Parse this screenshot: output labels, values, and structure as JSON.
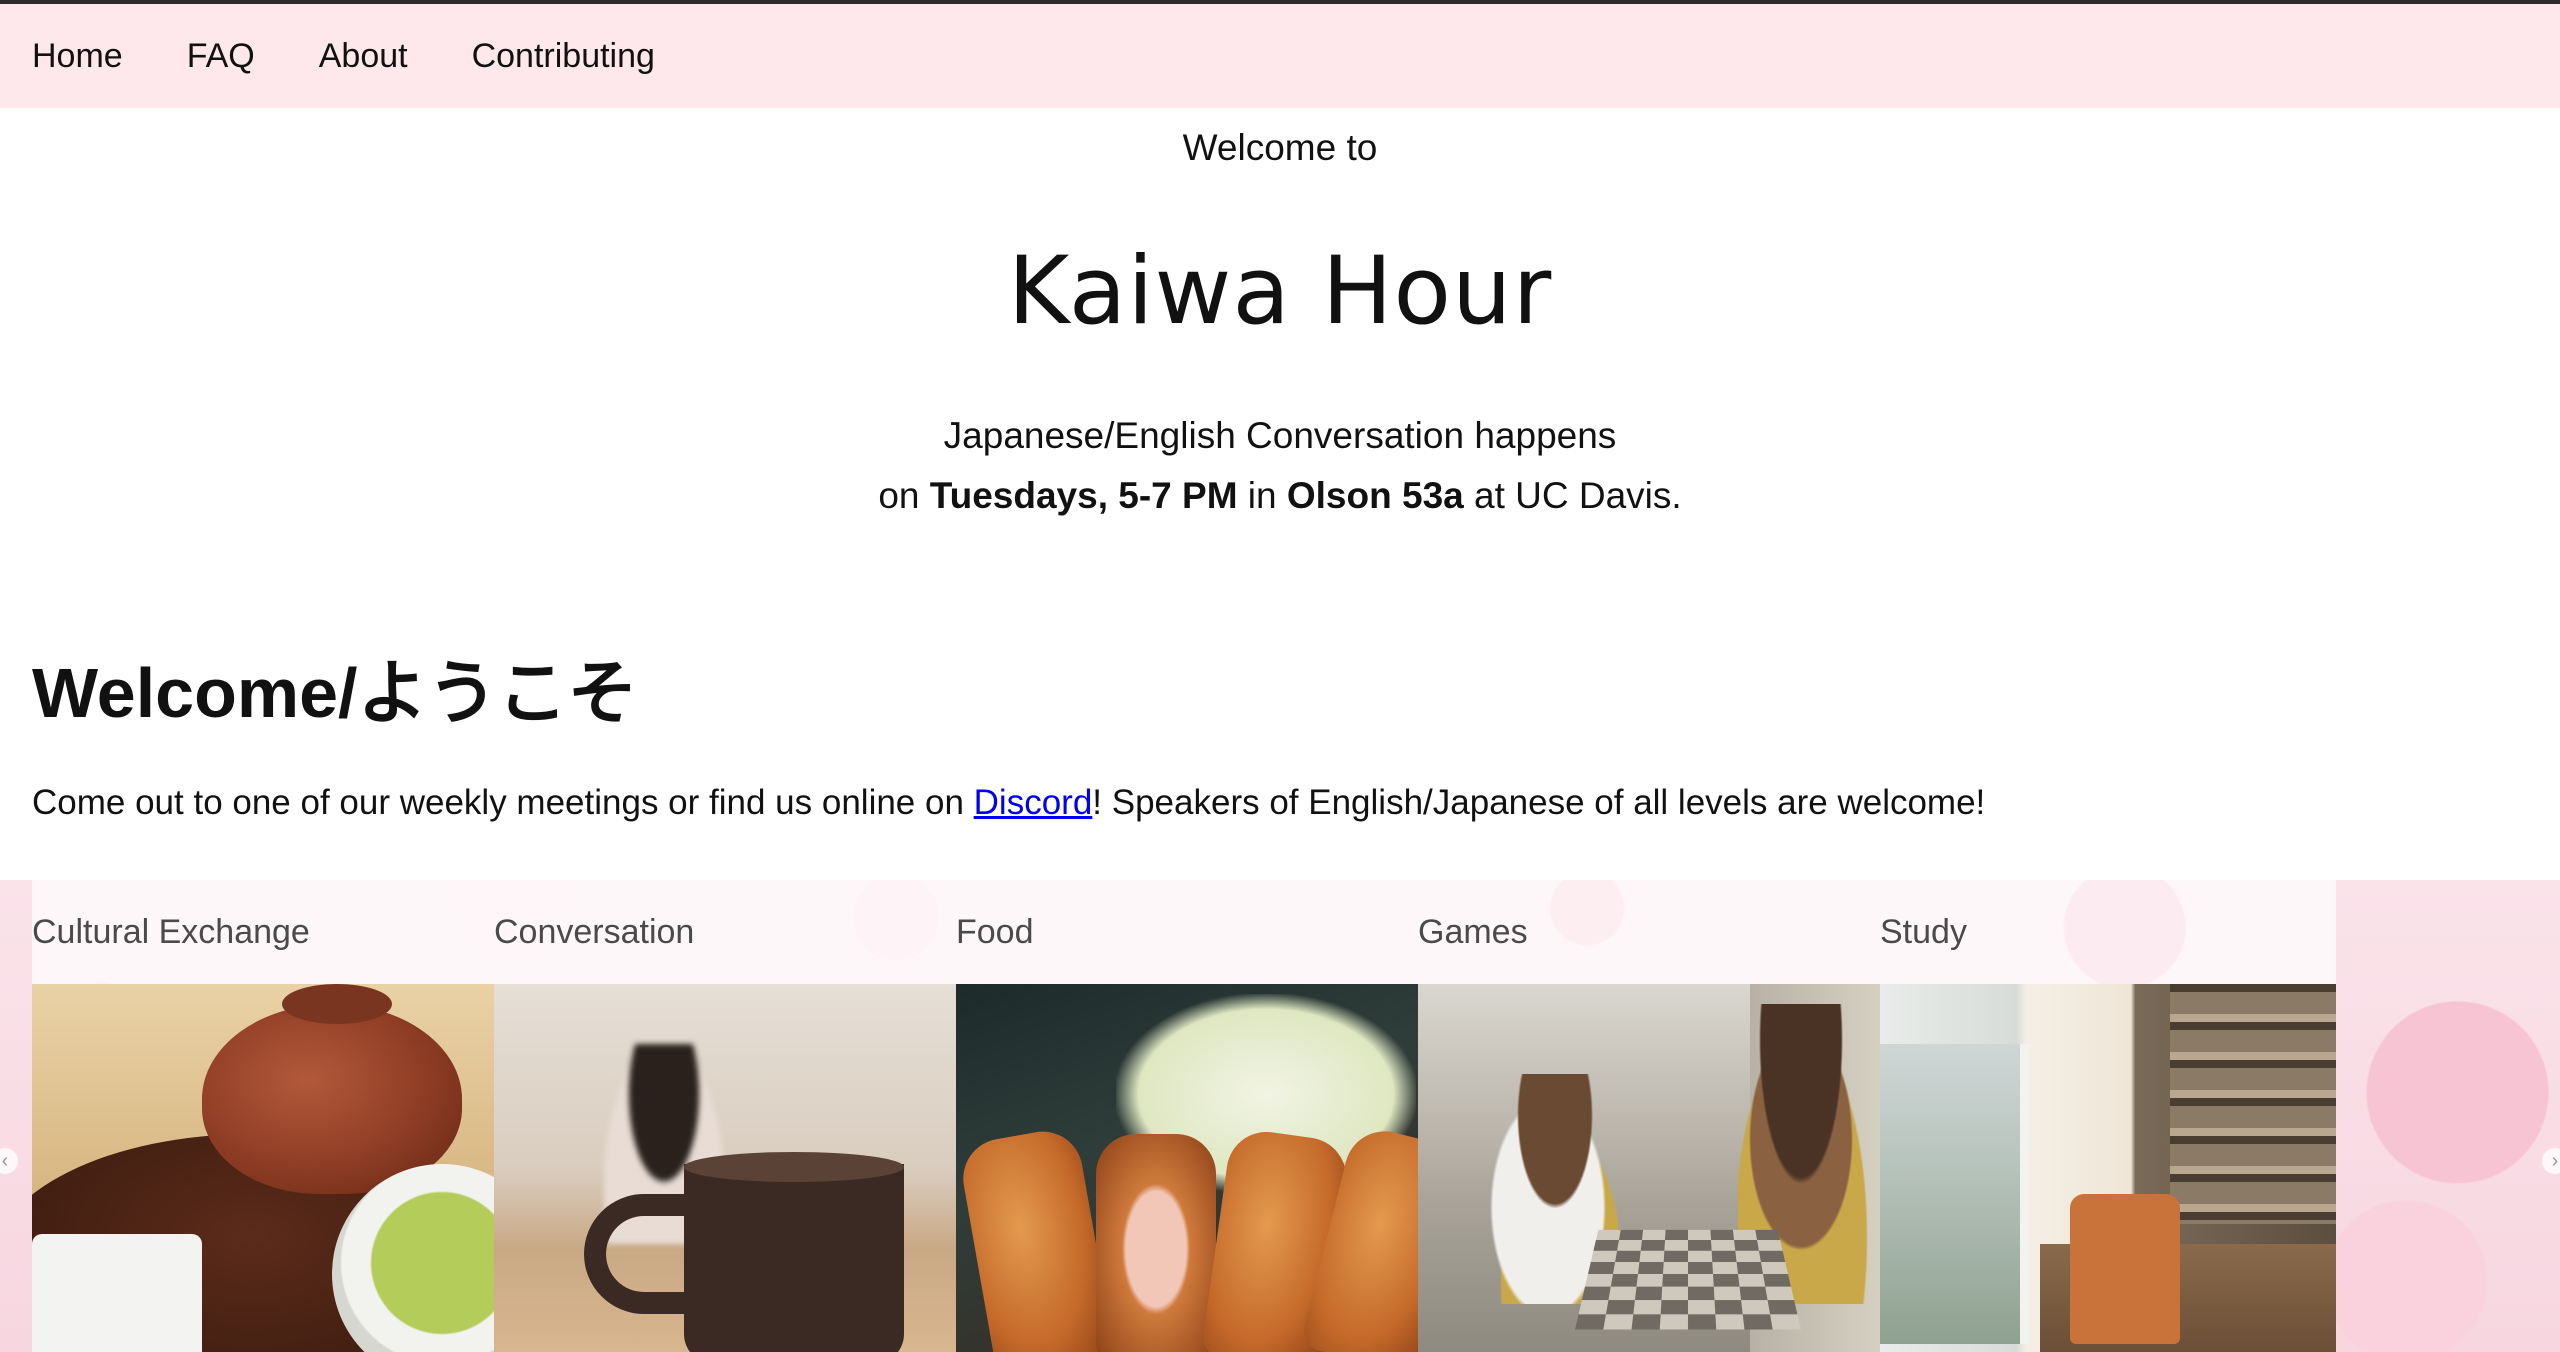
{
  "nav": {
    "items": [
      {
        "label": "Home"
      },
      {
        "label": "FAQ"
      },
      {
        "label": "About"
      },
      {
        "label": "Contributing"
      }
    ]
  },
  "hero": {
    "welcome_to": "Welcome to",
    "title": "Kaiwa Hour",
    "tagline_line1": "Japanese/English Conversation happens",
    "tagline_on": "on ",
    "tagline_when": "Tuesdays, 5-7 PM",
    "tagline_in": " in ",
    "tagline_where": "Olson 53a",
    "tagline_end": " at UC Davis."
  },
  "intro": {
    "heading": "Welcome/ようこそ",
    "text_before": "Come out to one of our weekly meetings or find us online on ",
    "link_text": "Discord",
    "text_after": "! Speakers of English/Japanese of all levels are welcome!"
  },
  "gallery": {
    "cards": [
      {
        "label": "Cultural Exchange",
        "image": "teapot-and-tea-cups"
      },
      {
        "label": "Conversation",
        "image": "cafe-coffee-mug"
      },
      {
        "label": "Food",
        "image": "tonkatsu-with-cabbage"
      },
      {
        "label": "Games",
        "image": "boys-playing-chess"
      },
      {
        "label": "Study",
        "image": "library-with-chair"
      }
    ],
    "prev_icon": "‹",
    "next_icon": "›"
  }
}
